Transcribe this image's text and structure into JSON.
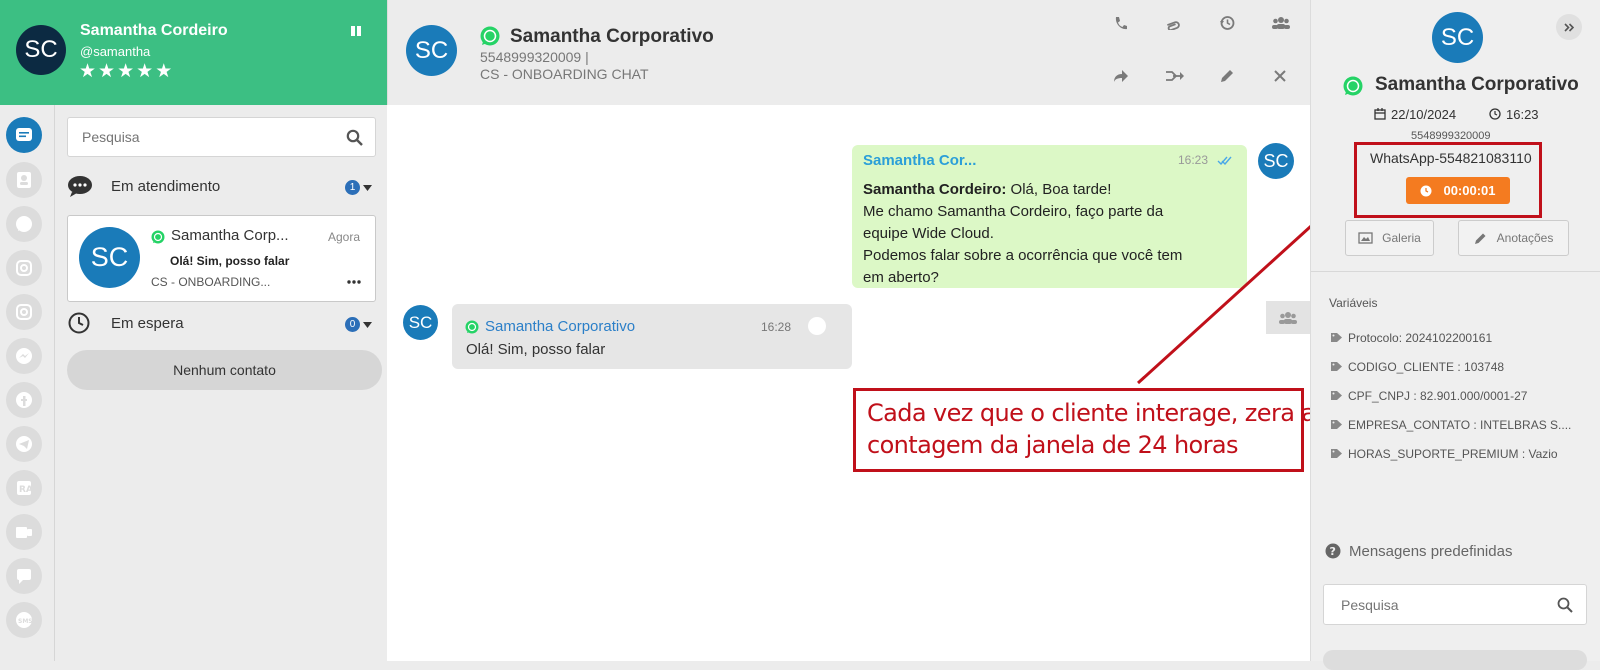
{
  "agent": {
    "initials": "SC",
    "name": "Samantha Cordeiro",
    "handle": "@samantha",
    "rating": 5
  },
  "search": {
    "placeholder": "Pesquisa"
  },
  "sections": {
    "in_service": {
      "label": "Em atendimento",
      "count": "1"
    },
    "waiting": {
      "label": "Em espera",
      "count": "0"
    },
    "no_contact": "Nenhum contato"
  },
  "contact_card": {
    "initials": "SC",
    "name": "Samantha Corp...",
    "time": "Agora",
    "last_message": "Olá! Sim, posso falar",
    "queue": "CS - ONBOARDING..."
  },
  "chat": {
    "initials": "SC",
    "title": "Samantha Corporativo",
    "phone": "5548999320009 |",
    "queue": "CS - ONBOARDING CHAT"
  },
  "messages": [
    {
      "sender": "Samantha Cor...",
      "time": "16:23",
      "author": "Samantha Cordeiro:",
      "line1": " Olá, Boa tarde!",
      "line2": "Me chamo Samantha Cordeiro, faço parte da",
      "line3": "equipe Wide Cloud.",
      "line4": "Podemos falar sobre a ocorrência que você tem",
      "line5": "em aberto?",
      "avatar": "SC"
    },
    {
      "sender": "Samantha Corporativo",
      "time": "16:28",
      "text": "Olá! Sim, posso falar",
      "avatar": "SC"
    }
  ],
  "annotation": {
    "line1": "Cada vez que o cliente interage, zera a",
    "line2": "contagem da janela de 24 horas"
  },
  "details": {
    "initials": "SC",
    "name": "Samantha Corporativo",
    "date": "22/10/2024",
    "time": "16:23",
    "phone": "5548999320009",
    "channel": "WhatsApp-55482108311​0",
    "timer": "00:00:01",
    "gallery_label": "Galeria",
    "notes_label": "Anotações",
    "variables_title": "Variáveis",
    "variables": [
      "Protocolo: 2024102200161",
      "CODIGO_CLIENTE : 103748",
      "CPF_CNPJ : 82.901.000/0001-27",
      "EMPRESA_CONTATO : INTELBRAS S....",
      "HORAS_SUPORTE_PREMIUM : Vazio"
    ],
    "predefined_title": "Mensagens predefinidas",
    "predefined_search_placeholder": "Pesquisa"
  },
  "colors": {
    "brand_green": "#3cbf83",
    "avatar_blue": "#1a7bb9",
    "outgoing_bubble": "#dcf8c6",
    "timer_orange": "#f47b20",
    "annotation_red": "#c0101a",
    "whatsapp_green": "#25d366"
  }
}
